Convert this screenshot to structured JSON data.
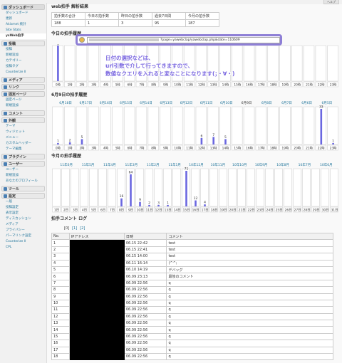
{
  "help_label": "ヘルプ",
  "colors": {
    "bar": "#6a67e0",
    "annotation": "#7b68e0",
    "link": "#21759b"
  },
  "sidebar": [
    {
      "head": "ダッシュボード",
      "icon": "dashboard-icon",
      "items": [
        "ダッシュボード",
        "更新",
        "Akismet 統計",
        "Site Stats",
        "ysWeb拍手"
      ],
      "current": 4
    },
    {
      "head": "投稿",
      "icon": "pin-icon",
      "items": [
        "投稿",
        "新規追加",
        "カテゴリー",
        "投稿タグ",
        "Counterize II"
      ]
    },
    {
      "head": "メディア",
      "icon": "media-icon",
      "items": []
    },
    {
      "head": "リンク",
      "icon": "link-icon",
      "items": []
    },
    {
      "head": "固定ページ",
      "icon": "page-icon",
      "items": [
        "固定ページ",
        "新規追加"
      ]
    },
    {
      "head": "コメント",
      "icon": "comment-icon",
      "items": []
    },
    {
      "head": "外観",
      "icon": "appearance-icon",
      "items": [
        "テーマ",
        "ウィジェット",
        "メニュー",
        "カスタムヘッダー",
        "テーマ編集"
      ]
    },
    {
      "head": "プラグイン",
      "icon": "plugin-icon",
      "items": []
    },
    {
      "head": "ユーザー",
      "icon": "users-icon",
      "items": [
        "ユーザー",
        "新規追加",
        "あなたのプロフィール"
      ]
    },
    {
      "head": "ツール",
      "icon": "tools-icon",
      "items": []
    },
    {
      "head": "設定",
      "icon": "settings-icon",
      "items": [
        "一般",
        "投稿設定",
        "表示設定",
        "ディスカッション",
        "メディア",
        "プライバシー",
        "パーマリンク設定",
        "Counterize II",
        "CPL"
      ]
    }
  ],
  "page": {
    "title": "web拍手 解析結果"
  },
  "summary": {
    "headers": [
      "拍手数の合計",
      "今日の拍手数",
      "昨日の拍手数",
      "過去7日間",
      "今月の拍手数"
    ],
    "values": [
      "188",
      "1",
      "3",
      "95",
      "187"
    ]
  },
  "url_popup": {
    "text": "?page=yawebclap/yawebclap.php&date=110609"
  },
  "annotation": [
    "日付の選択などは、",
    "url引数で介して行ってきますので、",
    "数値なクエリを入れると変なことになります(；・∀・)"
  ],
  "chart_data": [
    {
      "type": "bar",
      "title": "今日の拍手履歴",
      "categories": [
        "0時",
        "1時",
        "2時",
        "3時",
        "4時",
        "5時",
        "6時",
        "7時",
        "8時",
        "9時",
        "10時",
        "11時",
        "12時",
        "13時",
        "14時",
        "15時",
        "16時",
        "17時",
        "18時",
        "19時",
        "20時",
        "21時",
        "22時",
        "23時"
      ],
      "values": [
        1,
        0,
        0,
        0,
        0,
        0,
        0,
        0,
        0,
        0,
        0,
        0,
        0,
        0,
        0,
        0,
        0,
        0,
        0,
        0,
        0,
        0,
        0,
        0
      ]
    },
    {
      "type": "bar",
      "title": "6月9日の拍手履歴",
      "links": [
        "6月18日",
        "6月17日",
        "6月16日",
        "6月15日",
        "6月14日",
        "6月13日",
        "6月12日",
        "6月11日",
        "6月10日",
        "6月9日",
        "6月8日",
        "6月7日",
        "6月6日",
        "6月5日"
      ],
      "categories": [
        "0時",
        "1時",
        "2時",
        "3時",
        "4時",
        "5時",
        "6時",
        "7時",
        "8時",
        "9時",
        "10時",
        "11時",
        "12時",
        "13時",
        "14時",
        "15時",
        "16時",
        "17時",
        "18時",
        "19時",
        "20時",
        "21時",
        "22時",
        "23時"
      ],
      "values": [
        1,
        2,
        5,
        0,
        0,
        0,
        0,
        0,
        0,
        0,
        0,
        0,
        6,
        7,
        5,
        0,
        0,
        0,
        0,
        0,
        0,
        0,
        33,
        1
      ]
    },
    {
      "type": "bar",
      "title": "今月の拍手履歴",
      "links": [
        "11年6月",
        "11年5月",
        "11年4月",
        "11年3月",
        "11年2月",
        "11年1月",
        "10年12月",
        "10年11月",
        "10年10月",
        "10年9月",
        "10年8月",
        "10年7月",
        "10年6月"
      ],
      "categories": [
        "1日",
        "2日",
        "3日",
        "4日",
        "5日",
        "6日",
        "7日",
        "8日",
        "9日",
        "10日",
        "11日",
        "12日",
        "13日",
        "14日",
        "15日",
        "16日",
        "17日",
        "18日",
        "19日",
        "20日",
        "21日",
        "22日",
        "23日",
        "24日",
        "25日",
        "26日",
        "27日",
        "28日",
        "29日",
        "30日",
        "31日"
      ],
      "values": [
        0,
        0,
        0,
        0,
        0,
        0,
        0,
        16,
        64,
        9,
        2,
        3,
        1,
        0,
        71,
        12,
        4,
        0,
        0,
        0,
        0,
        0,
        0,
        0,
        0,
        0,
        0,
        0,
        0,
        0,
        0
      ]
    }
  ],
  "comment_log": {
    "title": "拍手コメント ログ",
    "pages": [
      "[0]",
      "[1]",
      "[2]"
    ],
    "headers": [
      "No.",
      "IPアドレス",
      "日時",
      "コメント"
    ],
    "rows": [
      [
        "1",
        "06.15 22:42",
        "test"
      ],
      [
        "2",
        "06.15 22:41",
        "test"
      ],
      [
        "3",
        "06.15 14:00",
        "test"
      ],
      [
        "4",
        "06.11 16:14",
        "(^^;"
      ],
      [
        "5",
        "06.10 14:19",
        "デバッグ"
      ],
      [
        "6",
        "06.09 23:13",
        "最後のコメント"
      ],
      [
        "7",
        "06.09 22:56",
        "q"
      ],
      [
        "8",
        "06.09 22:56",
        "q"
      ],
      [
        "9",
        "06.09 22:56",
        "q"
      ],
      [
        "10",
        "06.09 22:56",
        "q"
      ],
      [
        "11",
        "06.09 22:56",
        "q"
      ],
      [
        "12",
        "06.09 22:56",
        "q"
      ],
      [
        "13",
        "06.09 22:56",
        "q"
      ],
      [
        "14",
        "06.09 22:56",
        "q"
      ],
      [
        "15",
        "06.09 22:56",
        "q"
      ],
      [
        "16",
        "06.09 22:56",
        "q"
      ],
      [
        "17",
        "06.09 22:56",
        "q"
      ],
      [
        "18",
        "06.09 22:56",
        "q"
      ]
    ]
  }
}
